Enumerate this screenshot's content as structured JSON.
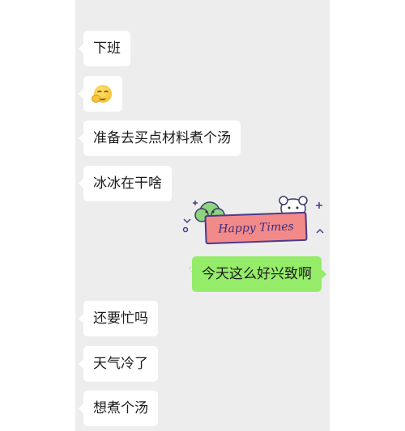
{
  "chat": {
    "messages": [
      {
        "side": "left",
        "text": "下班"
      },
      {
        "side": "left",
        "emoji": "hand-over-mouth-emoji"
      },
      {
        "side": "left",
        "text": "准备去买点材料煮个汤"
      },
      {
        "side": "left",
        "text": "冰冰在干啥"
      },
      {
        "side": "right",
        "sticker_text": "Happy Times"
      },
      {
        "side": "right",
        "text": "今天这么好兴致啊"
      },
      {
        "side": "left",
        "text": "还要忙吗"
      },
      {
        "side": "left",
        "text": "天气冷了"
      },
      {
        "side": "left",
        "text": "想煮个汤"
      }
    ]
  },
  "colors": {
    "background": "#ededed",
    "incoming_bubble": "#ffffff",
    "outgoing_bubble": "#95ec69",
    "sticker_banner": "#f28a8a"
  }
}
